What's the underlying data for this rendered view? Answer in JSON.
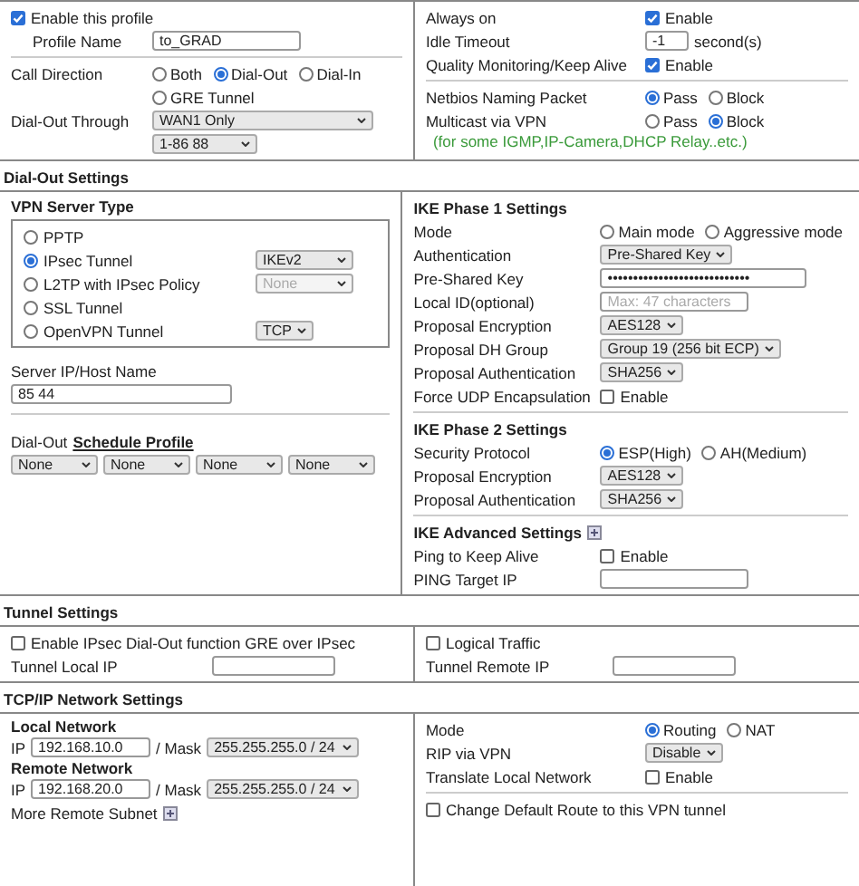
{
  "general": {
    "left": {
      "enable": {
        "label": "Enable this profile",
        "checked": true
      },
      "profile_name": {
        "label": "Profile Name",
        "value": "to_GRAD"
      },
      "call_direction": {
        "label": "Call Direction",
        "options": [
          {
            "label": "Both",
            "selected": false
          },
          {
            "label": "Dial-Out",
            "selected": true
          },
          {
            "label": "Dial-In",
            "selected": false
          },
          {
            "label": "GRE Tunnel",
            "selected": false
          }
        ]
      },
      "dial_out_through": {
        "label": "Dial-Out Through",
        "value": "WAN1 Only",
        "secondary": "1-86 88"
      }
    },
    "right": {
      "rows": [
        {
          "kind": "check",
          "label": "Always on",
          "text": "Enable",
          "checked": true
        },
        {
          "kind": "input",
          "label": "Idle Timeout",
          "value": "-1",
          "unit": "second(s)"
        },
        {
          "kind": "check",
          "label": "Quality Monitoring/Keep Alive",
          "text": "Enable",
          "checked": true
        },
        {
          "kind": "divider"
        },
        {
          "kind": "radio",
          "label": "Netbios Naming Packet",
          "options": [
            {
              "label": "Pass",
              "selected": true
            },
            {
              "label": "Block",
              "selected": false
            }
          ]
        },
        {
          "kind": "radio",
          "label": "Multicast via VPN",
          "options": [
            {
              "label": "Pass",
              "selected": false
            },
            {
              "label": "Block",
              "selected": true
            }
          ]
        },
        {
          "kind": "note",
          "text": "(for some IGMP,IP-Camera,DHCP Relay..etc.)"
        }
      ]
    }
  },
  "dial_out": {
    "title": "Dial-Out Settings",
    "vpn_type": {
      "title": "VPN Server Type",
      "options": [
        {
          "label": "PPTP",
          "selected": false
        },
        {
          "label": "IPsec Tunnel",
          "selected": true,
          "select": {
            "value": "IKEv2",
            "disabled": false
          }
        },
        {
          "label": "L2TP with IPsec Policy",
          "selected": false,
          "select": {
            "value": "None",
            "disabled": true
          }
        },
        {
          "label": "SSL Tunnel",
          "selected": false
        },
        {
          "label": "OpenVPN Tunnel",
          "selected": false,
          "select": {
            "value": "TCP",
            "disabled": false
          }
        }
      ]
    },
    "server": {
      "label": "Server IP/Host Name",
      "value": "85 44"
    },
    "schedule": {
      "label": "Dial-Out",
      "link": "Schedule Profile",
      "values": [
        "None",
        "None",
        "None",
        "None"
      ]
    },
    "sections": [
      {
        "title": "IKE Phase 1 Settings",
        "rows": [
          {
            "kind": "radio",
            "label": "Mode",
            "options": [
              {
                "label": "Main mode",
                "selected": false
              },
              {
                "label": "Aggressive mode",
                "selected": false
              }
            ]
          },
          {
            "kind": "select",
            "label": "Authentication",
            "value": "Pre-Shared Key"
          },
          {
            "kind": "input",
            "label": "Pre-Shared Key",
            "value": "••••••••••••••••••••••••••••"
          },
          {
            "kind": "input",
            "label": "Local ID(optional)",
            "placeholder": "Max: 47 characters"
          },
          {
            "kind": "select",
            "label": "Proposal Encryption",
            "value": "AES128"
          },
          {
            "kind": "select",
            "label": "Proposal DH Group",
            "value": "Group 19 (256 bit ECP)"
          },
          {
            "kind": "select",
            "label": "Proposal Authentication",
            "value": "SHA256"
          },
          {
            "kind": "check",
            "label": "Force UDP Encapsulation",
            "text": "Enable",
            "checked": false
          }
        ]
      },
      {
        "title": "IKE Phase 2 Settings",
        "rows": [
          {
            "kind": "radio",
            "label": "Security Protocol",
            "options": [
              {
                "label": "ESP(High)",
                "selected": true
              },
              {
                "label": "AH(Medium)",
                "selected": false
              }
            ]
          },
          {
            "kind": "select",
            "label": "Proposal Encryption",
            "value": "AES128"
          },
          {
            "kind": "select",
            "label": "Proposal Authentication",
            "value": "SHA256"
          }
        ]
      },
      {
        "title": "IKE Advanced Settings",
        "expand": true,
        "rows": [
          {
            "kind": "check",
            "label": "Ping to Keep Alive",
            "text": "Enable",
            "checked": false
          },
          {
            "kind": "input",
            "label": "PING Target IP"
          }
        ]
      }
    ]
  },
  "tunnel": {
    "title": "Tunnel Settings",
    "gre": {
      "label": "Enable IPsec Dial-Out function GRE over IPsec",
      "checked": false
    },
    "local_ip": {
      "label": "Tunnel Local IP"
    },
    "logical": {
      "label": "Logical Traffic",
      "checked": false
    },
    "remote_ip": {
      "label": "Tunnel Remote IP"
    }
  },
  "tcpip": {
    "title": "TCP/IP Network Settings",
    "networks": [
      {
        "title": "Local Network",
        "ip_label": "IP",
        "ip": "192.168.10.0",
        "mask_label": "/ Mask",
        "mask": "255.255.255.0 / 24"
      },
      {
        "title": "Remote Network",
        "ip_label": "IP",
        "ip": "192.168.20.0",
        "mask_label": "/ Mask",
        "mask": "255.255.255.0 / 24"
      }
    ],
    "more": "More Remote Subnet",
    "rows": [
      {
        "kind": "radio",
        "label": "Mode",
        "options": [
          {
            "label": "Routing",
            "selected": true
          },
          {
            "label": "NAT",
            "selected": false
          }
        ]
      },
      {
        "kind": "select",
        "label": "RIP via VPN",
        "value": "Disable"
      },
      {
        "kind": "check",
        "label": "Translate Local Network",
        "text": "Enable",
        "checked": false
      }
    ],
    "default_route": {
      "label": "Change Default Route to this VPN tunnel",
      "checked": false
    }
  }
}
